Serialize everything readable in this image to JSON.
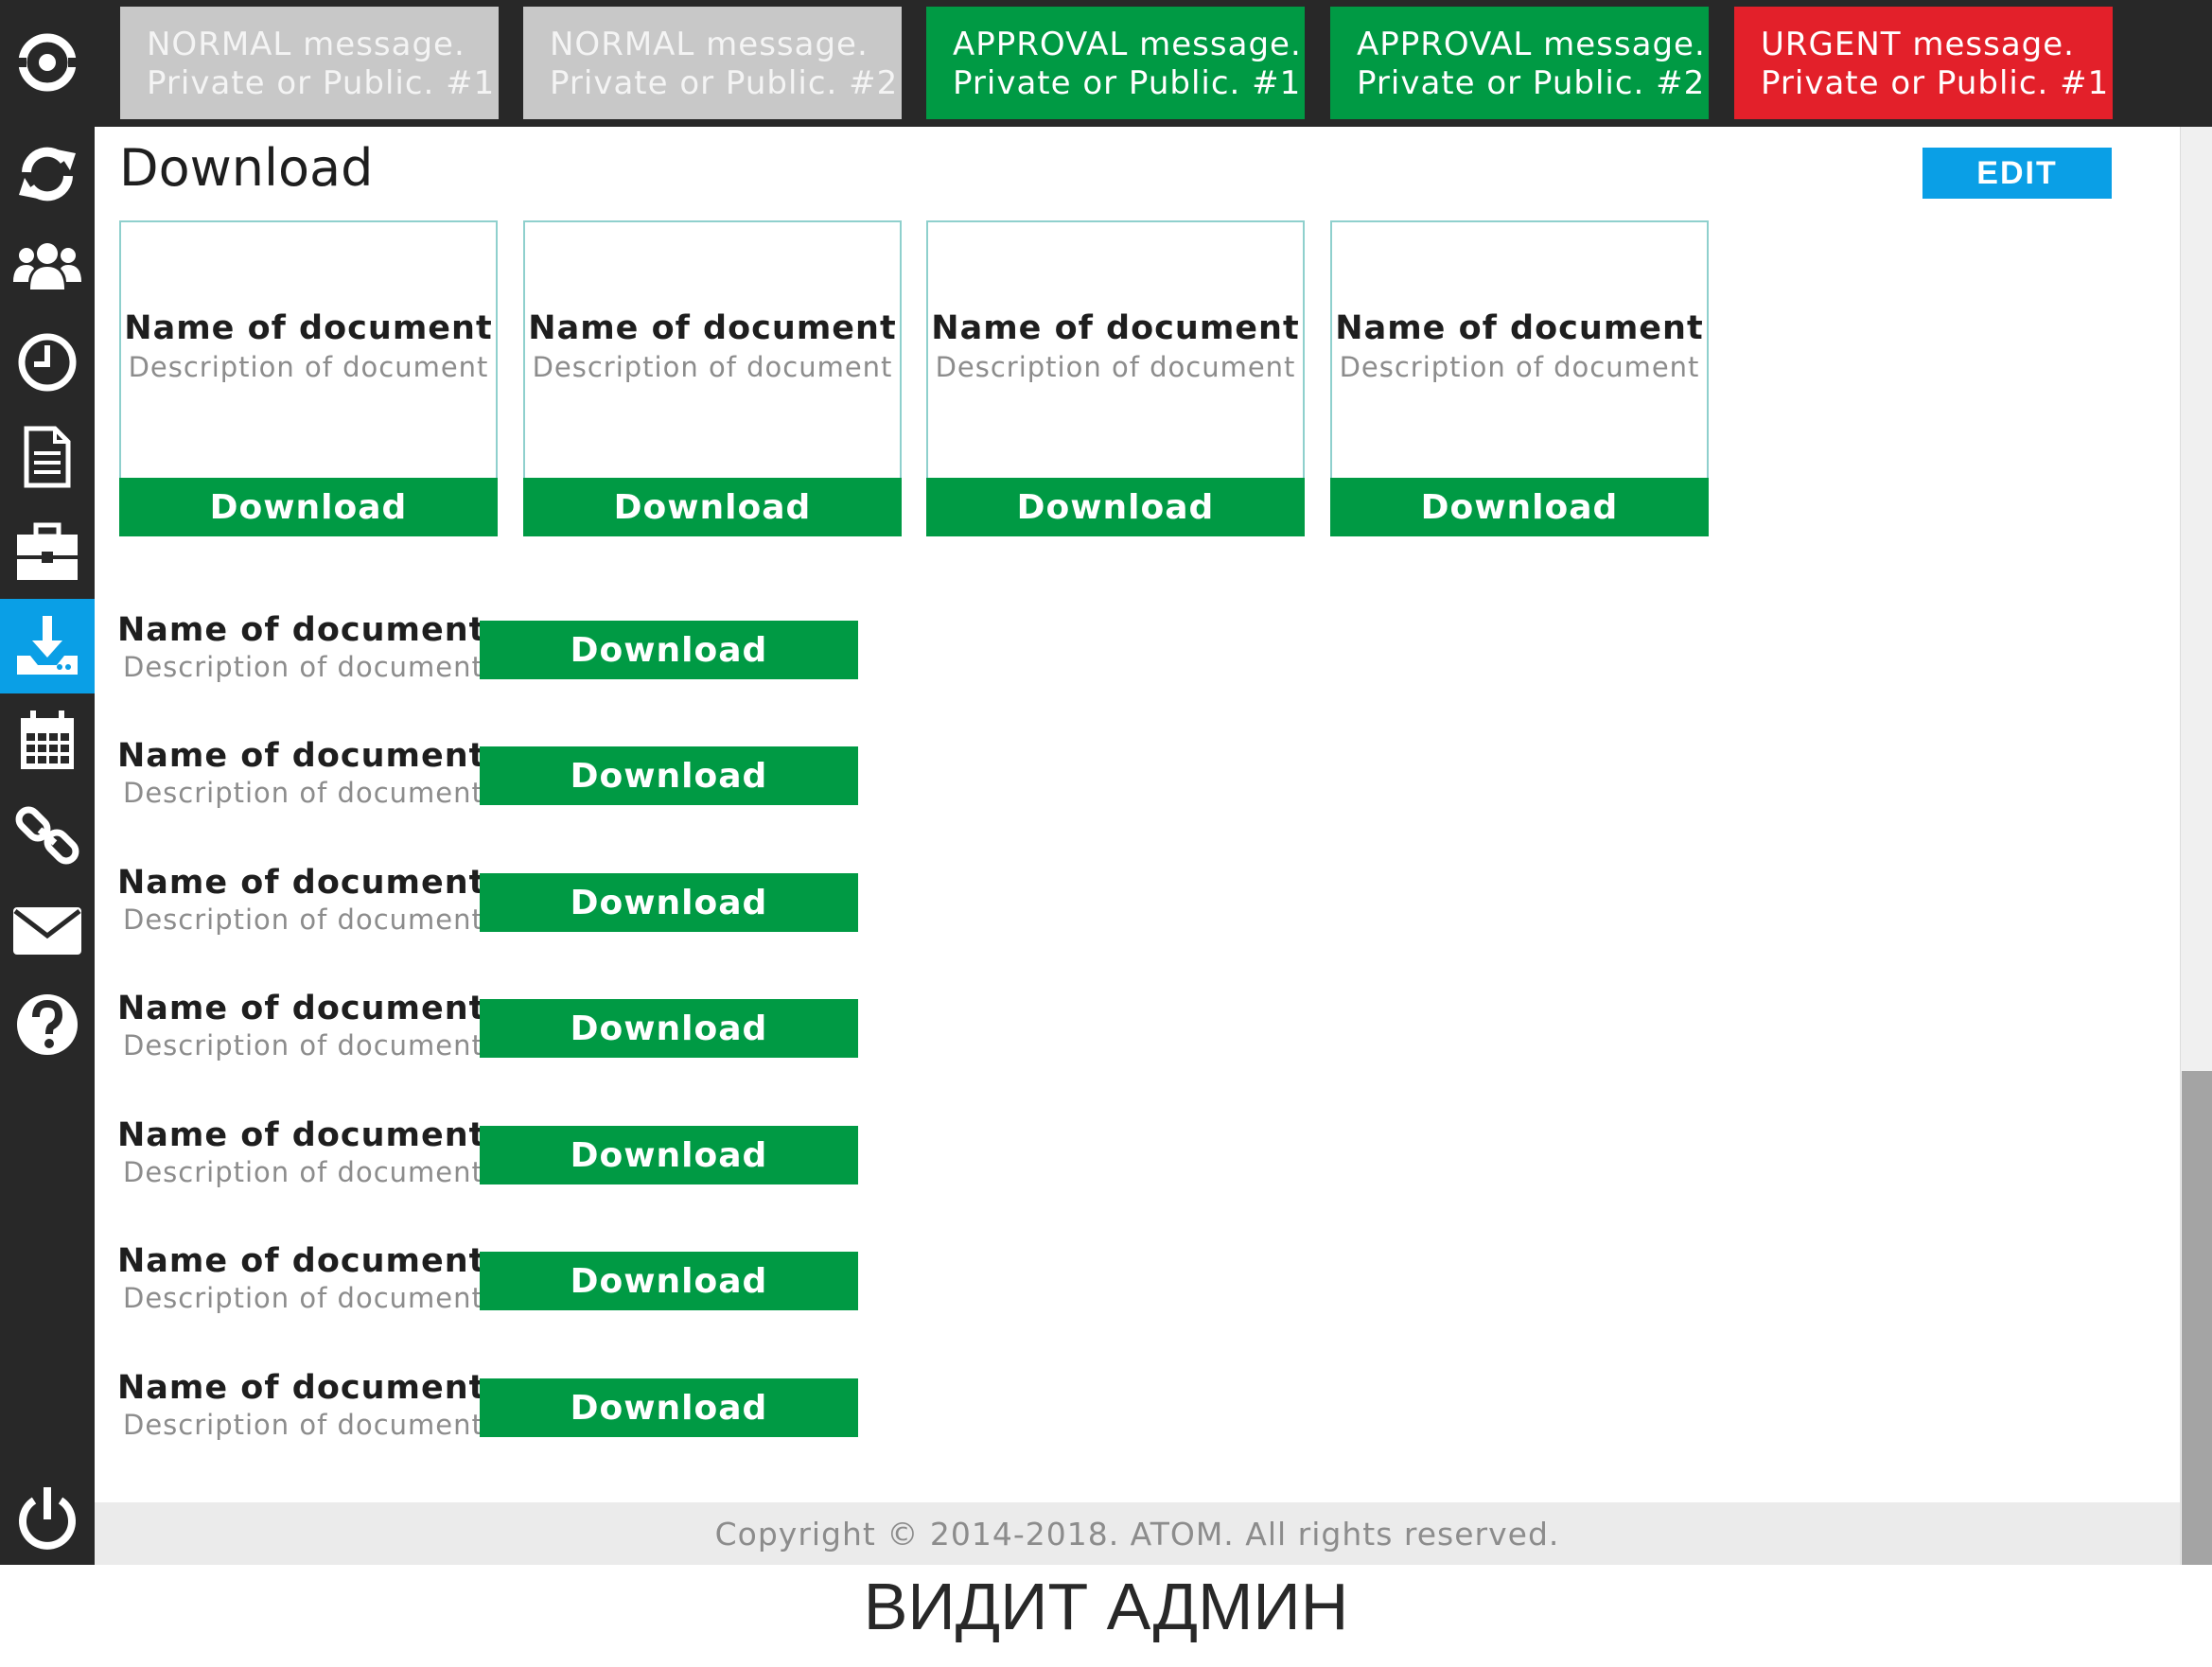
{
  "sidebar": {
    "items": [
      {
        "icon": "logo-icon",
        "active": false
      },
      {
        "icon": "refresh-icon",
        "active": false
      },
      {
        "icon": "users-icon",
        "active": false
      },
      {
        "icon": "clock-icon",
        "active": false
      },
      {
        "icon": "document-icon",
        "active": false
      },
      {
        "icon": "briefcase-icon",
        "active": false
      },
      {
        "icon": "download-icon",
        "active": true
      },
      {
        "icon": "calendar-icon",
        "active": false
      },
      {
        "icon": "link-icon",
        "active": false
      },
      {
        "icon": "mail-icon",
        "active": false
      },
      {
        "icon": "help-icon",
        "active": false
      },
      {
        "icon": "power-icon",
        "active": false
      }
    ],
    "active_color": "#0a9fe6",
    "background": "#282828"
  },
  "messages": [
    {
      "type": "normal",
      "line1": "NORMAL message.",
      "line2": "Private or Public. #1"
    },
    {
      "type": "normal",
      "line1": "NORMAL message.",
      "line2": "Private or Public. #2"
    },
    {
      "type": "approval",
      "line1": "APPROVAL message.",
      "line2": "Private or Public. #1"
    },
    {
      "type": "approval",
      "line1": "APPROVAL message.",
      "line2": "Private or Public. #2"
    },
    {
      "type": "urgent",
      "line1": "URGENT message.",
      "line2": "Private or Public. #1"
    }
  ],
  "colors": {
    "normal": "#c8c8c8",
    "approval": "#009a44",
    "urgent": "#e3202a",
    "download": "#009a44",
    "edit": "#0a9fe6"
  },
  "page": {
    "title": "Download",
    "edit_label": "EDIT"
  },
  "cards": [
    {
      "name": "Name of document",
      "description": "Description of document",
      "button": "Download"
    },
    {
      "name": "Name of document",
      "description": "Description of document",
      "button": "Download"
    },
    {
      "name": "Name of document",
      "description": "Description of document",
      "button": "Download"
    },
    {
      "name": "Name of document",
      "description": "Description of document",
      "button": "Download"
    }
  ],
  "rows": [
    {
      "name": "Name of document",
      "description": "Description of document",
      "button": "Download"
    },
    {
      "name": "Name of document",
      "description": "Description of document",
      "button": "Download"
    },
    {
      "name": "Name of document",
      "description": "Description of document",
      "button": "Download"
    },
    {
      "name": "Name of document",
      "description": "Description of document",
      "button": "Download"
    },
    {
      "name": "Name of document",
      "description": "Description of document",
      "button": "Download"
    },
    {
      "name": "Name of document",
      "description": "Description of document",
      "button": "Download"
    },
    {
      "name": "Name of document",
      "description": "Description of document",
      "button": "Download"
    }
  ],
  "footer": {
    "copyright": "Copyright © 2014-2018. ATOM. All rights reserved."
  },
  "caption": "ВИДИТ АДМИН"
}
